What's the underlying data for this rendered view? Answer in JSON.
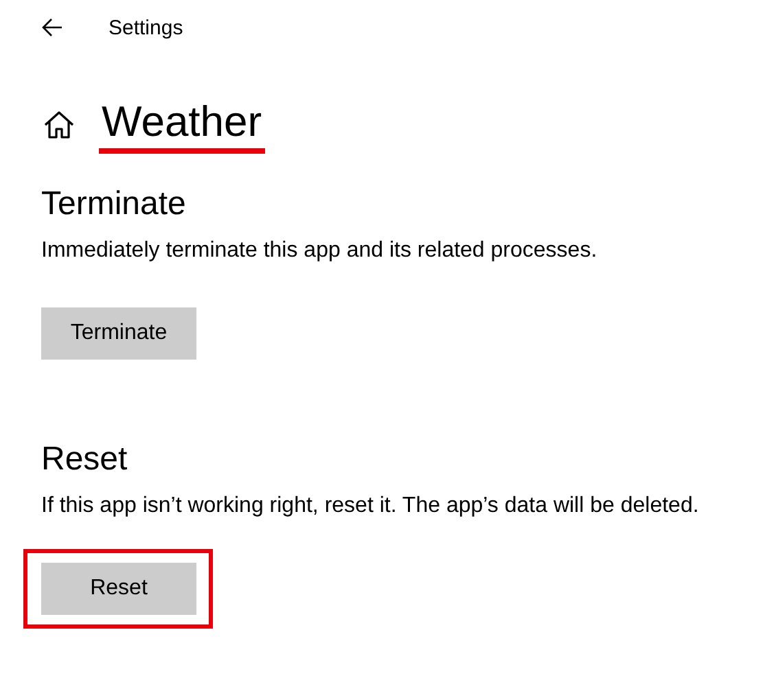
{
  "window": {
    "title": "Settings"
  },
  "page": {
    "title": "Weather",
    "underlined": true
  },
  "sections": [
    {
      "heading": "Terminate",
      "description": "Immediately terminate this app and its related processes.",
      "button": "Terminate",
      "highlighted": false
    },
    {
      "heading": "Reset",
      "description": "If this app isn’t working right, reset it. The app’s data will be deleted.",
      "button": "Reset",
      "highlighted": true
    }
  ]
}
